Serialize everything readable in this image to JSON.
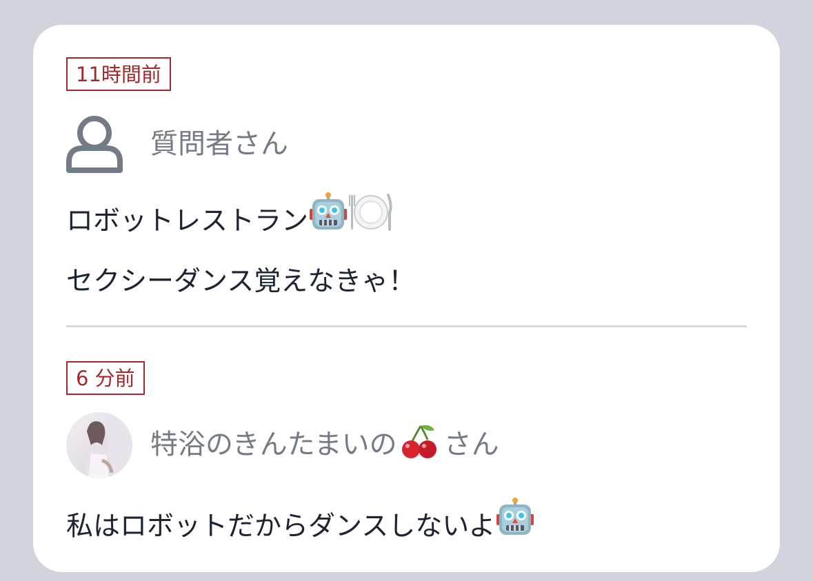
{
  "posts": [
    {
      "time": "11時間前",
      "user": {
        "name": "質問者さん",
        "avatar": "person-outline-icon"
      },
      "lines": [
        "ロボットレストラン",
        "セクシーダンス覚えなきゃ！"
      ],
      "line1_emojis": [
        "robot-emoji",
        "fork-knife-plate-emoji"
      ]
    },
    {
      "time": "6 分前",
      "user": {
        "name_prefix": "特浴のきんたまいの",
        "name_suffix": "さん",
        "name_emoji": "cherries-emoji",
        "avatar": "profile-photo"
      },
      "lines": [
        "私はロボットだからダンスしないよ"
      ],
      "line1_emojis": [
        "robot-emoji"
      ]
    }
  ],
  "colors": {
    "background": "#d1d4dc",
    "card": "#ffffff",
    "badge": "#a5282a",
    "username": "#737b86",
    "body_text": "#1c2433",
    "divider": "#d7d8dc"
  }
}
